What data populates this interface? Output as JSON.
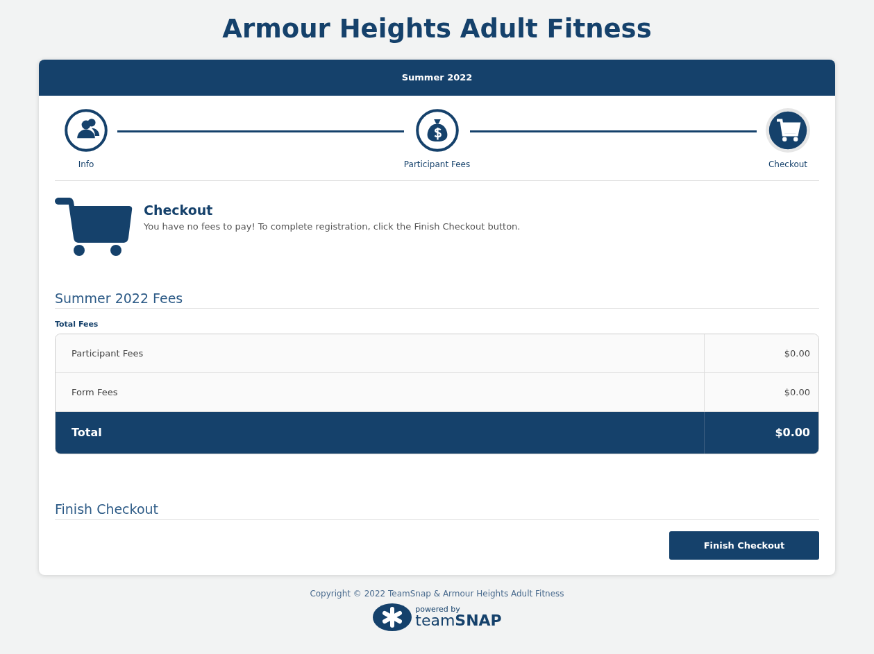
{
  "page_title": "Armour Heights Adult Fitness",
  "card_header": "Summer 2022",
  "steps": [
    {
      "label": "Info",
      "kind": "people",
      "selected": false
    },
    {
      "label": "Participant Fees",
      "kind": "money",
      "selected": false
    },
    {
      "label": "Checkout",
      "kind": "cart",
      "selected": true
    }
  ],
  "checkout": {
    "heading": "Checkout",
    "message": "You have no fees to pay! To complete registration, click the Finish Checkout button."
  },
  "fees_section": {
    "heading": "Summer 2022 Fees",
    "table_label": "Total Fees",
    "rows": [
      {
        "label": "Participant Fees",
        "amount": "$0.00"
      },
      {
        "label": "Form Fees",
        "amount": "$0.00"
      }
    ],
    "total": {
      "label": "Total",
      "amount": "$0.00"
    }
  },
  "finish_section": {
    "heading": "Finish Checkout",
    "button": "Finish Checkout"
  },
  "footer": {
    "copyright": "Copyright © 2022 TeamSnap & Armour Heights Adult Fitness",
    "powered_by": "powered by",
    "brand": "team**SNAP**"
  }
}
